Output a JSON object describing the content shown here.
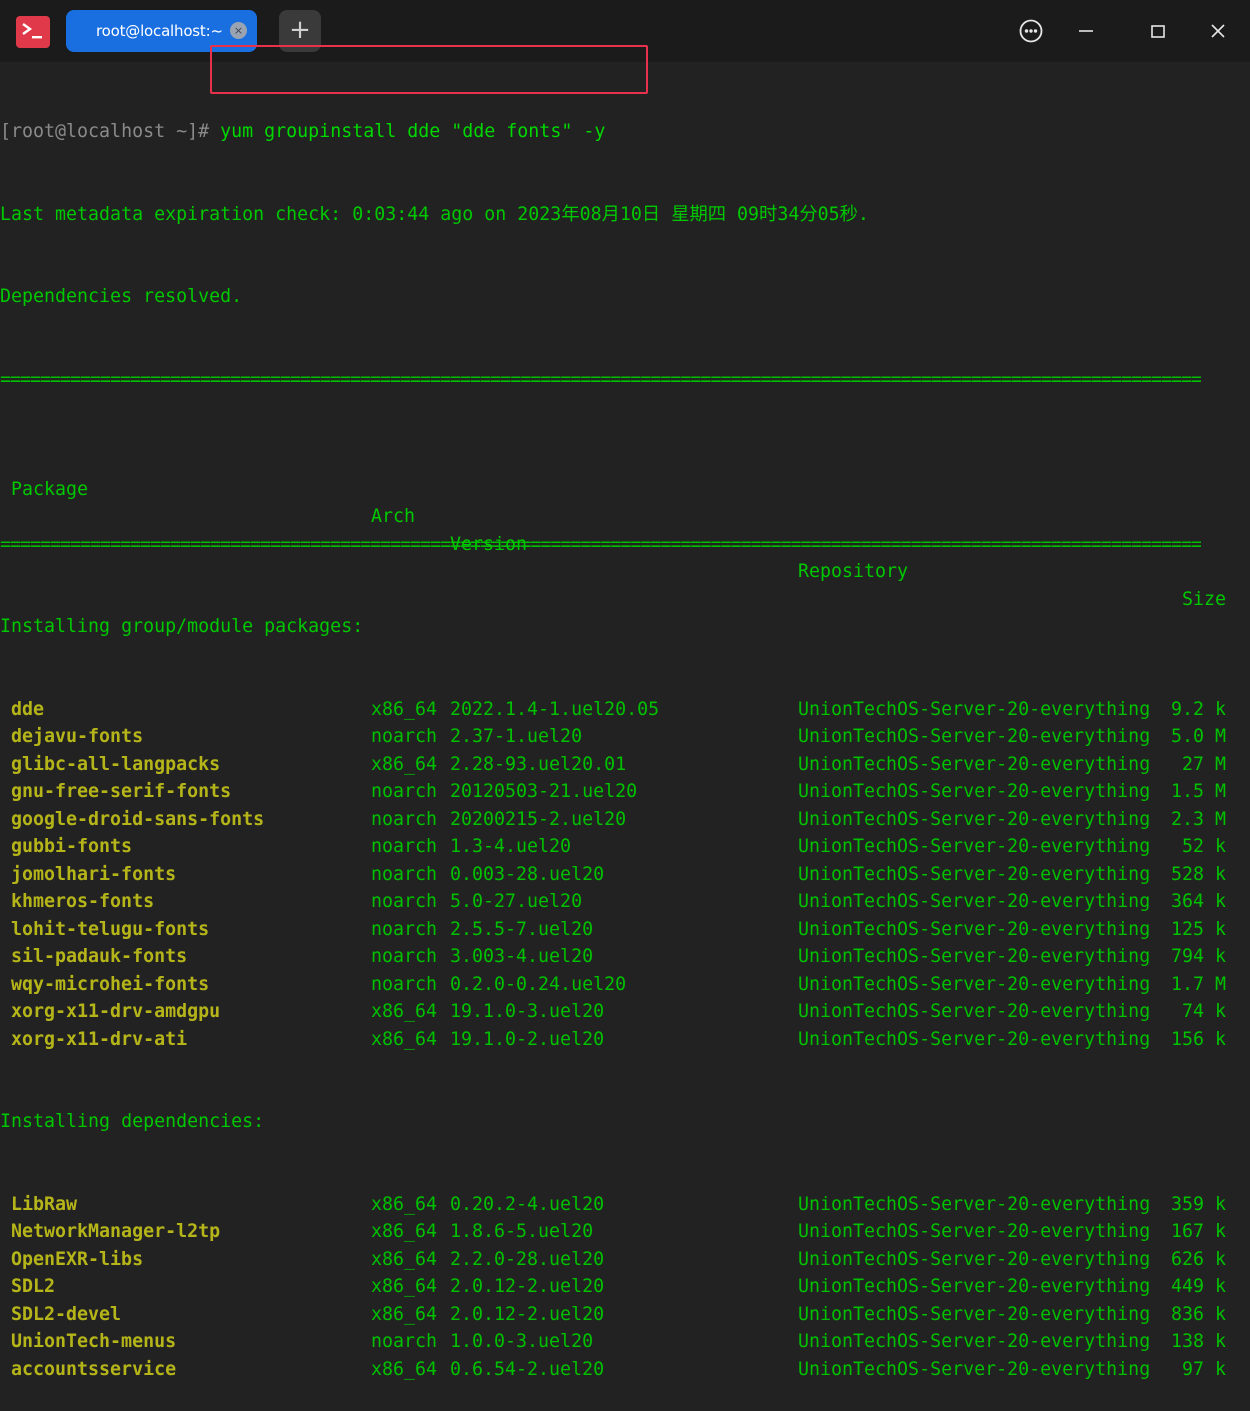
{
  "window": {
    "tab_title": "root@localhost:~",
    "tab_close": "×",
    "new_tab": "+"
  },
  "terminal": {
    "prompt": "[root@localhost ~]#",
    "command": " yum groupinstall dde \"dde fonts\" -y",
    "meta_line": "Last metadata expiration check: 0:03:44 ago on 2023年08月10日 星期四 09时34分05秒.",
    "deps_resolved": "Dependencies resolved.",
    "separator": "========================================================================================================================",
    "headers": {
      "package": "Package",
      "arch": "Arch",
      "version": "Version",
      "repository": "Repository",
      "size": "Size"
    },
    "group_section": "Installing group/module packages:",
    "group_packages": [
      {
        "name": "dde",
        "arch": "x86_64",
        "version": "2022.1.4-1.uel20.05",
        "repo": "UnionTechOS-Server-20-everything",
        "size": "9.2 k"
      },
      {
        "name": "dejavu-fonts",
        "arch": "noarch",
        "version": "2.37-1.uel20",
        "repo": "UnionTechOS-Server-20-everything",
        "size": "5.0 M"
      },
      {
        "name": "glibc-all-langpacks",
        "arch": "x86_64",
        "version": "2.28-93.uel20.01",
        "repo": "UnionTechOS-Server-20-everything",
        "size": "27 M"
      },
      {
        "name": "gnu-free-serif-fonts",
        "arch": "noarch",
        "version": "20120503-21.uel20",
        "repo": "UnionTechOS-Server-20-everything",
        "size": "1.5 M"
      },
      {
        "name": "google-droid-sans-fonts",
        "arch": "noarch",
        "version": "20200215-2.uel20",
        "repo": "UnionTechOS-Server-20-everything",
        "size": "2.3 M"
      },
      {
        "name": "gubbi-fonts",
        "arch": "noarch",
        "version": "1.3-4.uel20",
        "repo": "UnionTechOS-Server-20-everything",
        "size": "52 k"
      },
      {
        "name": "jomolhari-fonts",
        "arch": "noarch",
        "version": "0.003-28.uel20",
        "repo": "UnionTechOS-Server-20-everything",
        "size": "528 k"
      },
      {
        "name": "khmeros-fonts",
        "arch": "noarch",
        "version": "5.0-27.uel20",
        "repo": "UnionTechOS-Server-20-everything",
        "size": "364 k"
      },
      {
        "name": "lohit-telugu-fonts",
        "arch": "noarch",
        "version": "2.5.5-7.uel20",
        "repo": "UnionTechOS-Server-20-everything",
        "size": "125 k"
      },
      {
        "name": "sil-padauk-fonts",
        "arch": "noarch",
        "version": "3.003-4.uel20",
        "repo": "UnionTechOS-Server-20-everything",
        "size": "794 k"
      },
      {
        "name": "wqy-microhei-fonts",
        "arch": "noarch",
        "version": "0.2.0-0.24.uel20",
        "repo": "UnionTechOS-Server-20-everything",
        "size": "1.7 M"
      },
      {
        "name": "xorg-x11-drv-amdgpu",
        "arch": "x86_64",
        "version": "19.1.0-3.uel20",
        "repo": "UnionTechOS-Server-20-everything",
        "size": "74 k"
      },
      {
        "name": "xorg-x11-drv-ati",
        "arch": "x86_64",
        "version": "19.1.0-2.uel20",
        "repo": "UnionTechOS-Server-20-everything",
        "size": "156 k"
      }
    ],
    "deps_section": "Installing dependencies:",
    "dep_packages": [
      {
        "name": "LibRaw",
        "arch": "x86_64",
        "version": "0.20.2-4.uel20",
        "repo": "UnionTechOS-Server-20-everything",
        "size": "359 k"
      },
      {
        "name": "NetworkManager-l2tp",
        "arch": "x86_64",
        "version": "1.8.6-5.uel20",
        "repo": "UnionTechOS-Server-20-everything",
        "size": "167 k"
      },
      {
        "name": "OpenEXR-libs",
        "arch": "x86_64",
        "version": "2.2.0-28.uel20",
        "repo": "UnionTechOS-Server-20-everything",
        "size": "626 k"
      },
      {
        "name": "SDL2",
        "arch": "x86_64",
        "version": "2.0.12-2.uel20",
        "repo": "UnionTechOS-Server-20-everything",
        "size": "449 k"
      },
      {
        "name": "SDL2-devel",
        "arch": "x86_64",
        "version": "2.0.12-2.uel20",
        "repo": "UnionTechOS-Server-20-everything",
        "size": "836 k"
      },
      {
        "name": "UnionTech-menus",
        "arch": "noarch",
        "version": "1.0.0-3.uel20",
        "repo": "UnionTechOS-Server-20-everything",
        "size": "138 k"
      },
      {
        "name": "accountsservice",
        "arch": "x86_64",
        "version": "0.6.54-2.uel20",
        "repo": "UnionTechOS-Server-20-everything",
        "size": "97 k"
      }
    ]
  },
  "colors": {
    "background": "#222222",
    "titlebar": "#1b1b1b",
    "tab_active": "#1a6fe0",
    "app_logo": "#e03a4a",
    "terminal_green": "#00c800",
    "package_name": "#b5b51a",
    "highlight_box": "#e8324d"
  },
  "icons": {
    "app": "terminal-app-icon",
    "menu": "more-options-icon",
    "minimize": "minimize-icon",
    "maximize": "maximize-icon",
    "close": "close-icon"
  }
}
